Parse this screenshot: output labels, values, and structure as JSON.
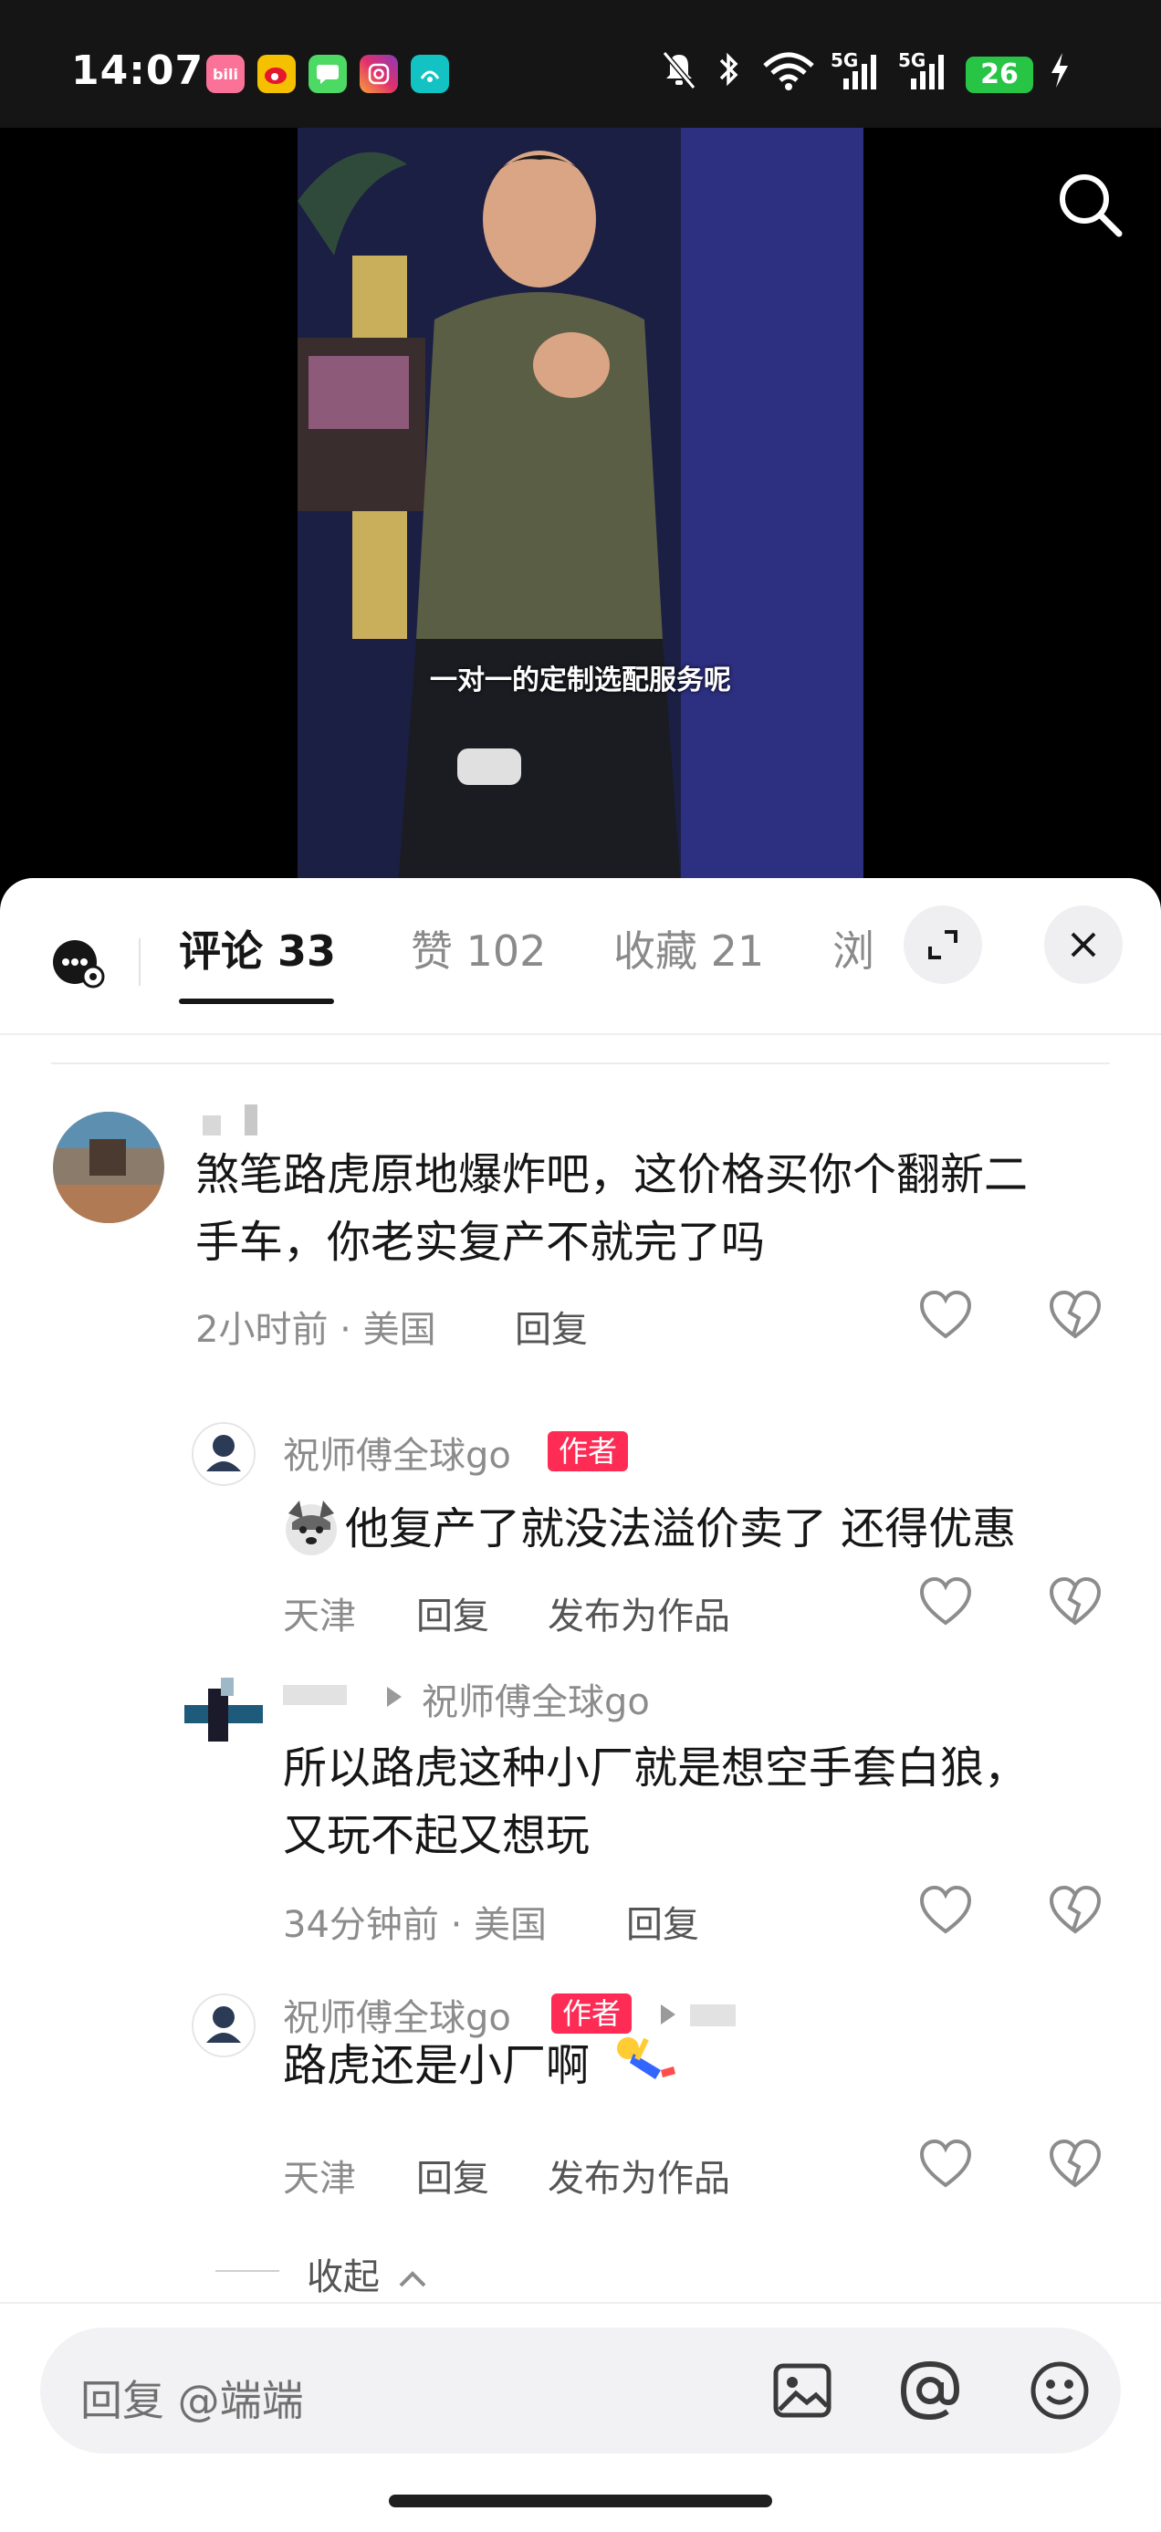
{
  "status_bar": {
    "time": "14:07",
    "apps": [
      "bilibili",
      "weibo",
      "messages",
      "instagram",
      "app"
    ],
    "network": [
      "5G",
      "5G"
    ],
    "battery": "26"
  },
  "video": {
    "subtitle": "一对一的定制选配服务呢"
  },
  "tabs": [
    {
      "label": "评论 33",
      "active": true
    },
    {
      "label": "赞 102",
      "active": false
    },
    {
      "label": "收藏 21",
      "active": false
    },
    {
      "label": "浏",
      "active": false
    }
  ],
  "comments": {
    "c1": {
      "username": "",
      "text_line1": "煞笔路虎原地爆炸吧，这价格买你个翻新二",
      "text_line2": "手车，你老实复产不就完了吗",
      "time": "2小时前 · 美国",
      "reply": "回复"
    },
    "r1": {
      "username": "祝师傅全球go",
      "badge": "作者",
      "text": "他复产了就没法溢价卖了 还得优惠",
      "location": "天津",
      "reply": "回复",
      "publish": "发布为作品"
    },
    "r2": {
      "reply_to": "祝师傅全球go",
      "text_line1": "所以路虎这种小厂就是想空手套白狼，",
      "text_line2": "又玩不起又想玩",
      "time": "34分钟前 · 美国",
      "reply": "回复"
    },
    "r3": {
      "username": "祝师傅全球go",
      "badge": "作者",
      "text": "路虎还是小厂啊",
      "location": "天津",
      "reply": "回复",
      "publish": "发布为作品"
    }
  },
  "collapse": "收起",
  "input": {
    "placeholder": "回复 @端端"
  },
  "colors": {
    "accent": "#fe2c55",
    "battery": "#28c445"
  }
}
